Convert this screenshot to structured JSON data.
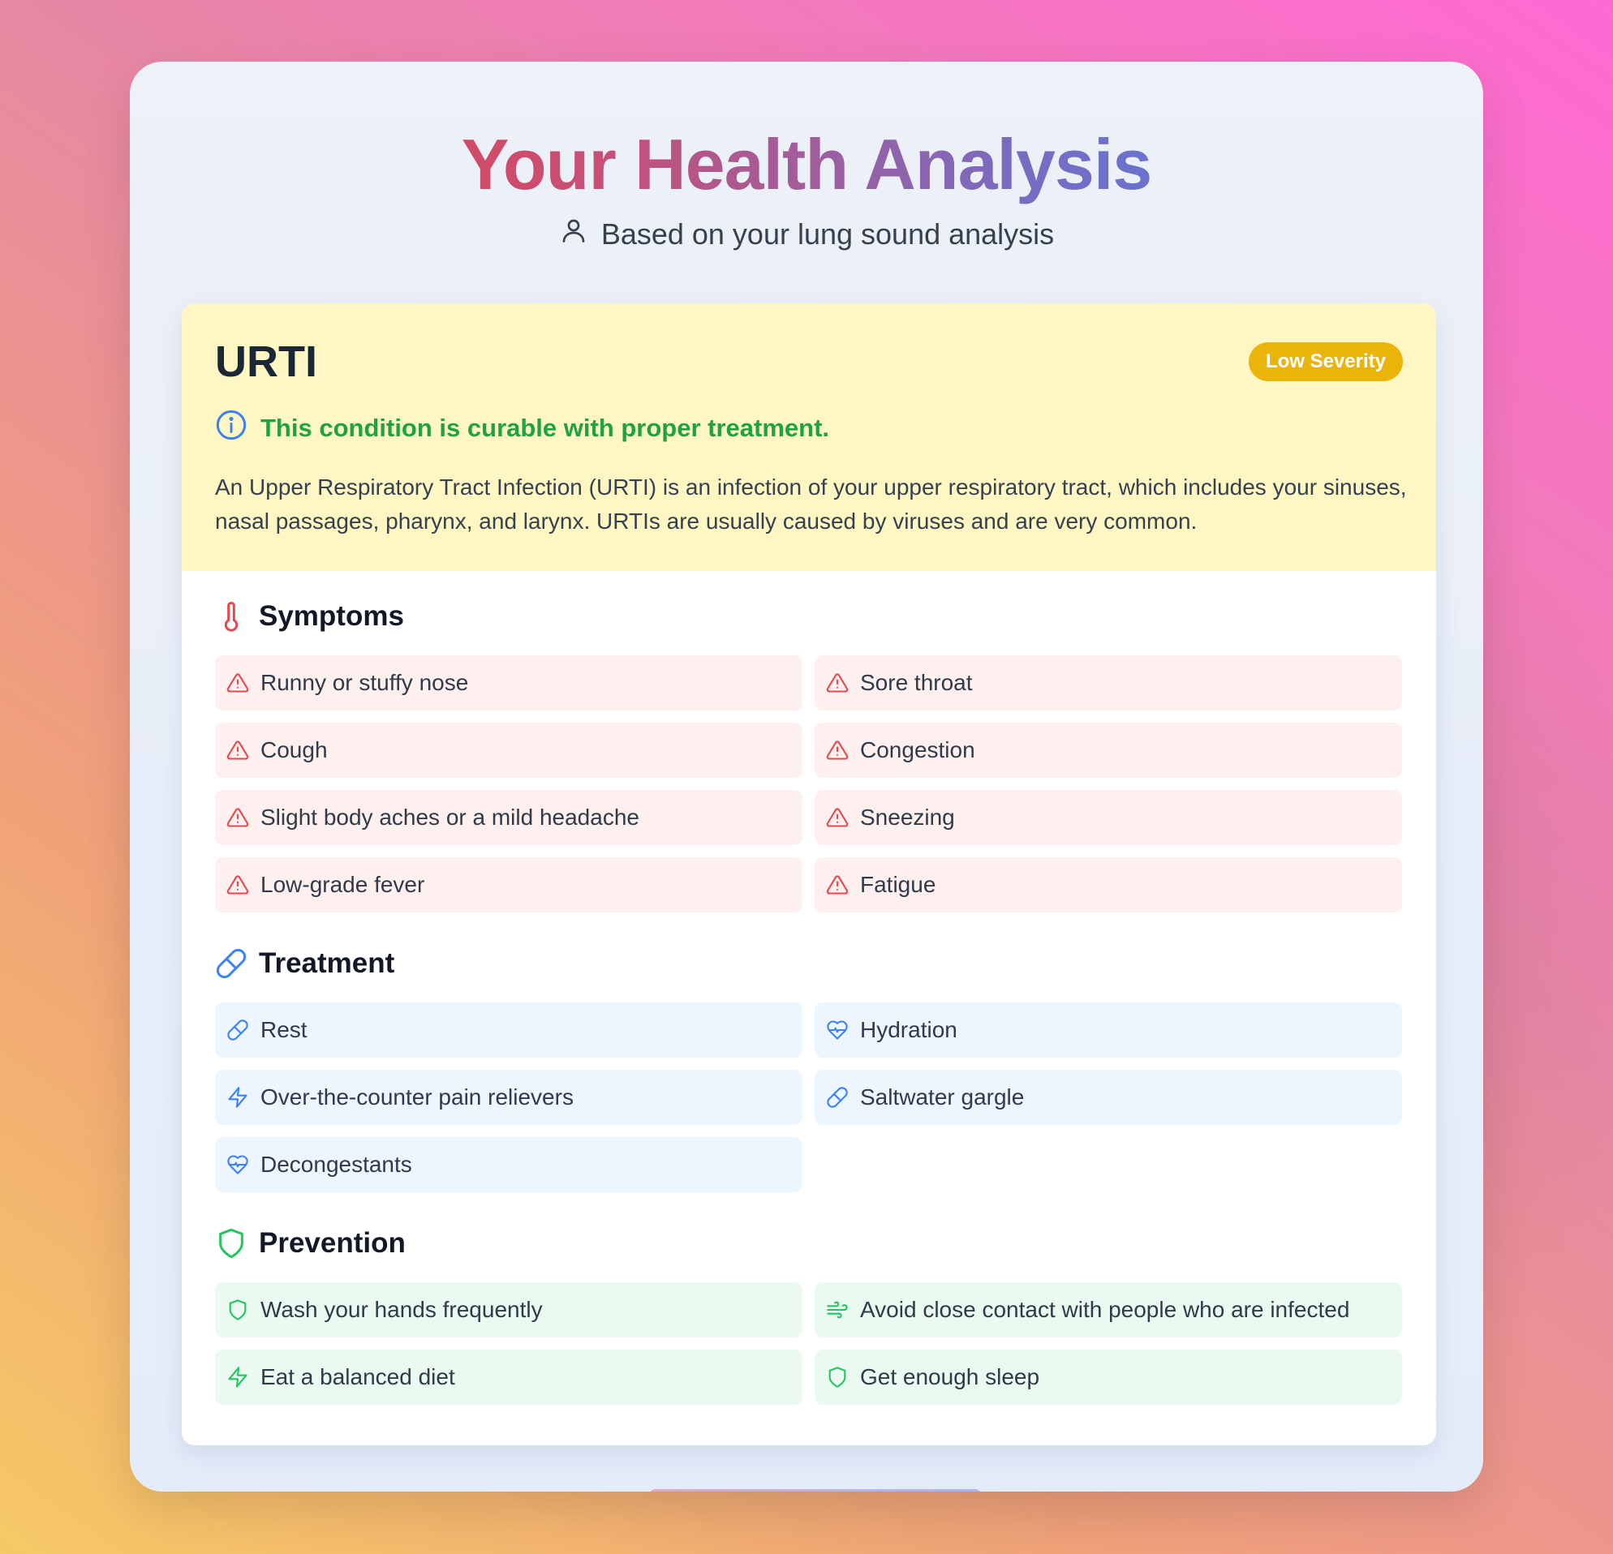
{
  "header": {
    "title": "Your Health Analysis",
    "subtitle": "Based on your lung sound analysis"
  },
  "condition": {
    "name": "URTI",
    "severity": "Low Severity",
    "curable_note": "This condition is curable with proper treatment.",
    "description": "An Upper Respiratory Tract Infection (URTI) is an infection of your upper respiratory tract, which includes your sinuses, nasal passages, pharynx, and larynx. URTIs are usually caused by viruses and are very common."
  },
  "symptoms": {
    "title": "Symptoms",
    "items": [
      {
        "label": "Runny or stuffy nose",
        "icon": "warning-icon"
      },
      {
        "label": "Sore throat",
        "icon": "warning-icon"
      },
      {
        "label": "Cough",
        "icon": "warning-icon"
      },
      {
        "label": "Congestion",
        "icon": "warning-icon"
      },
      {
        "label": "Slight body aches or a mild headache",
        "icon": "warning-icon"
      },
      {
        "label": "Sneezing",
        "icon": "warning-icon"
      },
      {
        "label": "Low-grade fever",
        "icon": "warning-icon"
      },
      {
        "label": "Fatigue",
        "icon": "warning-icon"
      }
    ]
  },
  "treatment": {
    "title": "Treatment",
    "items": [
      {
        "label": "Rest",
        "icon": "pill-icon"
      },
      {
        "label": "Hydration",
        "icon": "heart-pulse-icon"
      },
      {
        "label": "Over-the-counter pain relievers",
        "icon": "lightning-icon"
      },
      {
        "label": "Saltwater gargle",
        "icon": "pill-icon"
      },
      {
        "label": "Decongestants",
        "icon": "heart-pulse-icon"
      }
    ]
  },
  "prevention": {
    "title": "Prevention",
    "items": [
      {
        "label": "Wash your hands frequently",
        "icon": "shield-icon"
      },
      {
        "label": "Avoid close contact with people who are infected",
        "icon": "wind-icon"
      },
      {
        "label": "Eat a balanced diet",
        "icon": "lightning-icon"
      },
      {
        "label": "Get enough sleep",
        "icon": "shield-icon"
      }
    ]
  },
  "colors": {
    "symptom_icon": "#e5484d",
    "treatment_icon": "#3b82f6",
    "prevention_icon": "#22c55e",
    "severity_badge": "#ebb40a",
    "curable_text": "#22a142"
  }
}
